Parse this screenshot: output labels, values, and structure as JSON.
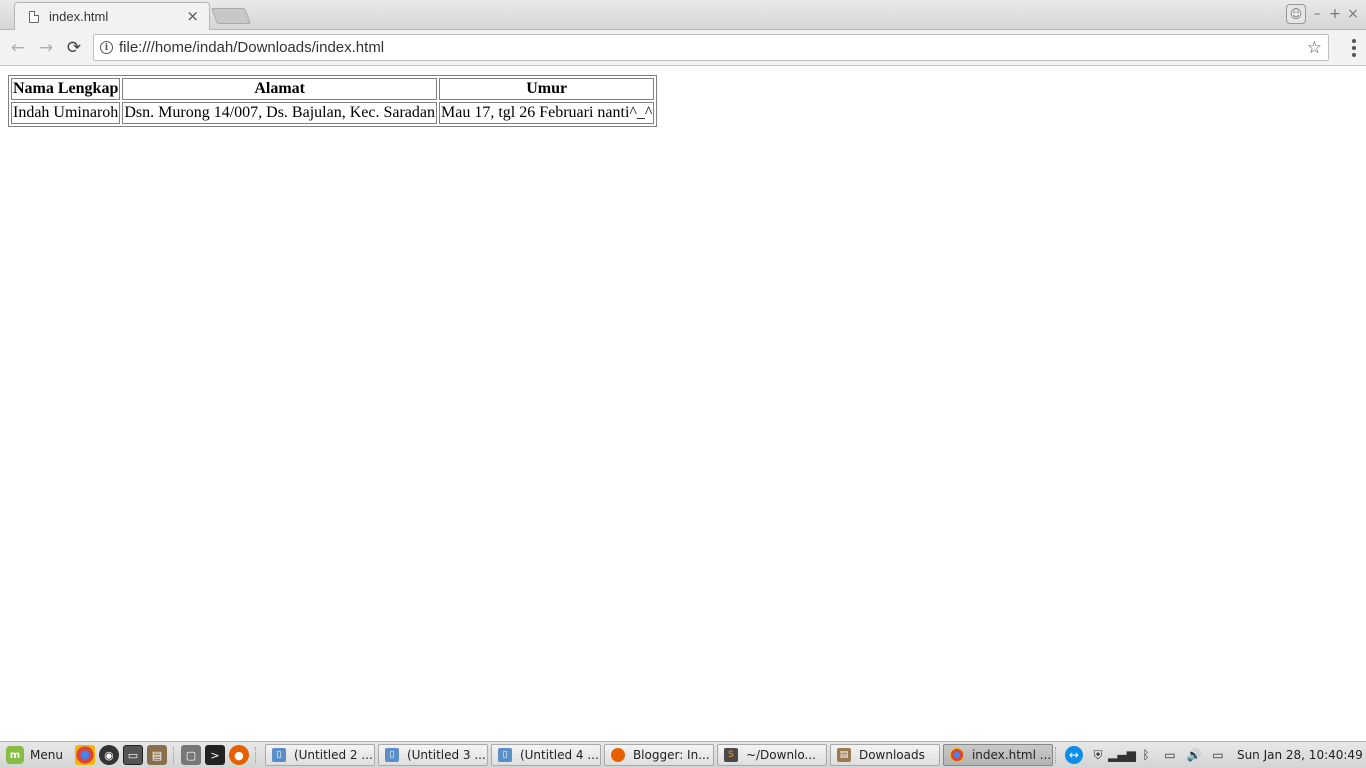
{
  "browser": {
    "tab_title": "index.html",
    "tab_close": "×",
    "url": "file:///home/indah/Downloads/index.html",
    "nav_back": "←",
    "nav_forward": "→",
    "nav_reload": "⟳",
    "star": "☆",
    "win_minimize": "–",
    "win_maximize": "+",
    "win_close": "×"
  },
  "page": {
    "table": {
      "headers": [
        "Nama Lengkap",
        "Alamat",
        "Umur"
      ],
      "rows": [
        [
          "Indah Uminaroh",
          "Dsn. Murong 14/007, Ds. Bajulan, Kec. Saradan",
          "Mau 17, tgl 26 Februari nanti^_^"
        ]
      ]
    }
  },
  "taskbar": {
    "menu_label": "Menu",
    "windows": [
      {
        "label": "(Untitled 2 ...",
        "icon": "text-editor-icon"
      },
      {
        "label": "(Untitled 3 ...",
        "icon": "text-editor-icon"
      },
      {
        "label": "(Untitled 4 ...",
        "icon": "text-editor-icon"
      },
      {
        "label": "Blogger: In...",
        "icon": "firefox-icon"
      },
      {
        "label": "~/Downlo...",
        "icon": "sublime-icon"
      },
      {
        "label": "Downloads",
        "icon": "folder-icon"
      },
      {
        "label": "index.html ...",
        "icon": "chrome-icon"
      }
    ],
    "clock": "Sun Jan 28, 10:40:49"
  },
  "colors": {
    "accent_mint": "#86be43",
    "chrome_red": "#db4437",
    "firefox_orange": "#e66000",
    "teamviewer_blue": "#0e8ee9"
  }
}
